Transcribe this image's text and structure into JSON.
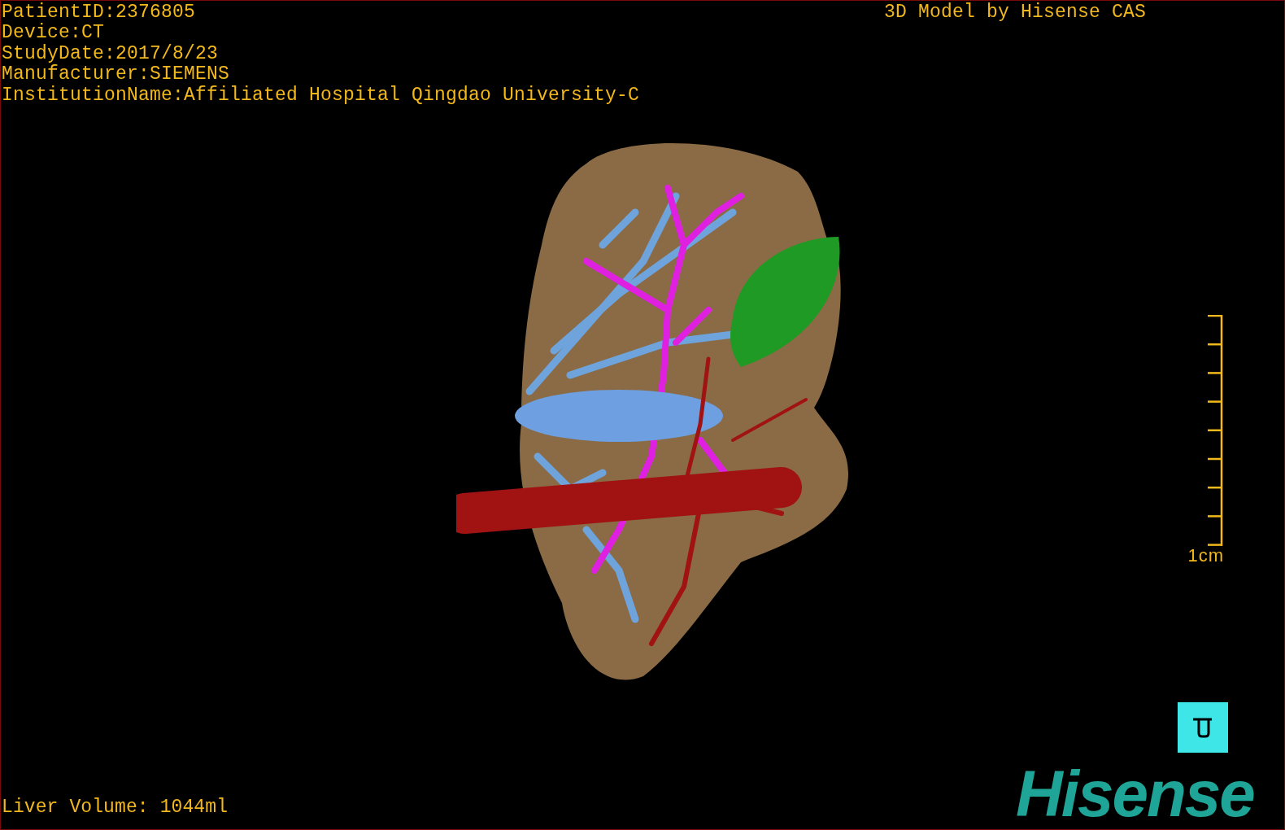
{
  "patient_info": [
    "PatientID:2376805",
    "Device:CT",
    "StudyDate:2017/8/23",
    "Manufacturer:SIEMENS",
    "InstitutionName:Affiliated Hospital Qingdao University-C"
  ],
  "header_title": "3D Model by Hisense CAS",
  "scale_bar": {
    "label": "1cm"
  },
  "liver_volume": "Liver Volume: 1044ml",
  "logo": "Hisense"
}
